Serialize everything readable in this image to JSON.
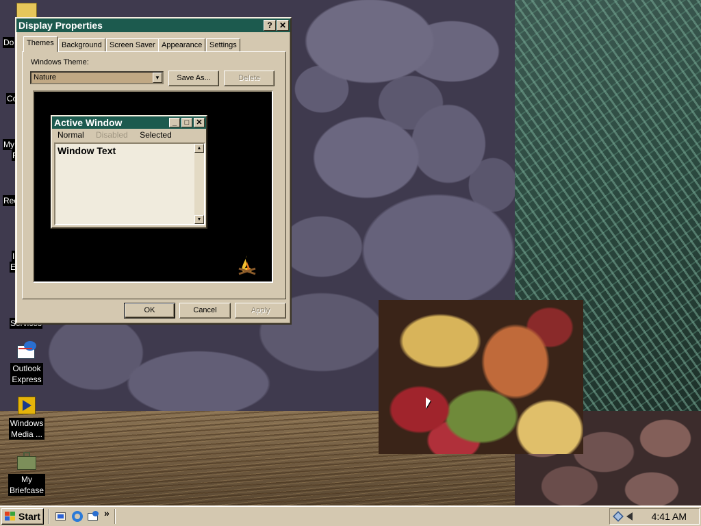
{
  "desktop": {
    "icons": [
      {
        "label_lines": [
          "Outlook",
          "Express"
        ]
      },
      {
        "label_lines": [
          "Windows",
          "Media ..."
        ]
      },
      {
        "label_lines": [
          "My",
          "Briefcase"
        ]
      }
    ],
    "partial_labels": [
      "Do",
      "Co",
      "My",
      "F",
      "Rec",
      "I",
      "E",
      "Services"
    ]
  },
  "display_properties": {
    "title": "Display Properties",
    "help_glyph": "?",
    "close_glyph": "✕",
    "tabs": [
      {
        "label": "Themes",
        "active": true
      },
      {
        "label": "Background",
        "active": false
      },
      {
        "label": "Screen Saver",
        "active": false
      },
      {
        "label": "Appearance",
        "active": false
      },
      {
        "label": "Settings",
        "active": false
      }
    ],
    "theme_label": "Windows Theme:",
    "theme_value": "Nature",
    "save_as_label": "Save As...",
    "delete_label": "Delete",
    "preview": {
      "active_window_title": "Active Window",
      "menu": {
        "normal": "Normal",
        "disabled": "Disabled",
        "selected": "Selected"
      },
      "window_text": "Window Text"
    },
    "ok_label": "OK",
    "cancel_label": "Cancel",
    "apply_label": "Apply"
  },
  "taskbar": {
    "start_label": "Start",
    "chevron": "»",
    "clock": "4:41 AM"
  },
  "colors": {
    "title_bar": "#1c5a4e",
    "face": "#d4c8b0",
    "combo_selected": "#c0a884"
  }
}
